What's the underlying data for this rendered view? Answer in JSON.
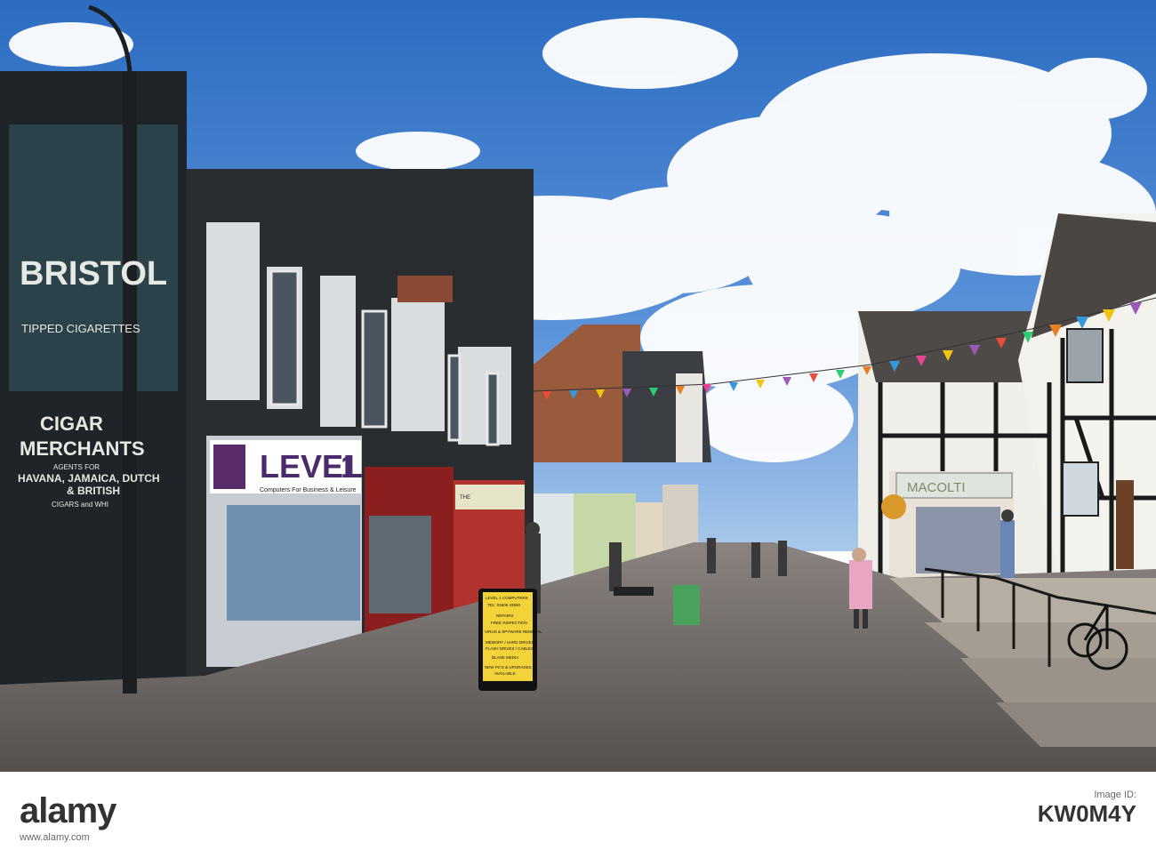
{
  "photo": {
    "wall_sign": {
      "line1": "BRISTOL",
      "line2": "TIPPED CIGARETTES",
      "line3": "CIGAR",
      "line4": "MERCHANTS",
      "line5": "AGENTS FOR",
      "line6": "HAVANA, JAMAICA, DUTCH",
      "line7": "& BRITISH",
      "line8": "CIGARS and WHI"
    },
    "shop1": {
      "name": "LEVEL",
      "num": "1",
      "tagline": "Computers For Business & Leisure"
    },
    "shop3": {
      "name": "THE"
    },
    "shop_right": {
      "name": "MACOLTI"
    },
    "aboard": {
      "line1": "LEVEL 1 COMPUTERS",
      "line2": "TEL: 01606 43550",
      "line3": "REPAIRS",
      "line4": "FREE INSPECTION",
      "line5": "VIRUS & SPYWARE REMOVAL",
      "line6": "MEMORY / HARD DRIVES",
      "line7": "FLASH DRIVES / CABLES",
      "line8": "BLANK MEDIA",
      "line9": "NEW PC'S & UPGRADES",
      "line10": "AVAILABLE"
    }
  },
  "banner": {
    "logo": "alamy",
    "stock_label": "Image ID:",
    "stock_id": "KW0M4Y",
    "website": "www.alamy.com"
  },
  "colors": {
    "sky_top": "#2f6fc4",
    "sky_bottom": "#8db8e6",
    "pavement": "#6b625e",
    "building_dark": "#1f2326"
  }
}
